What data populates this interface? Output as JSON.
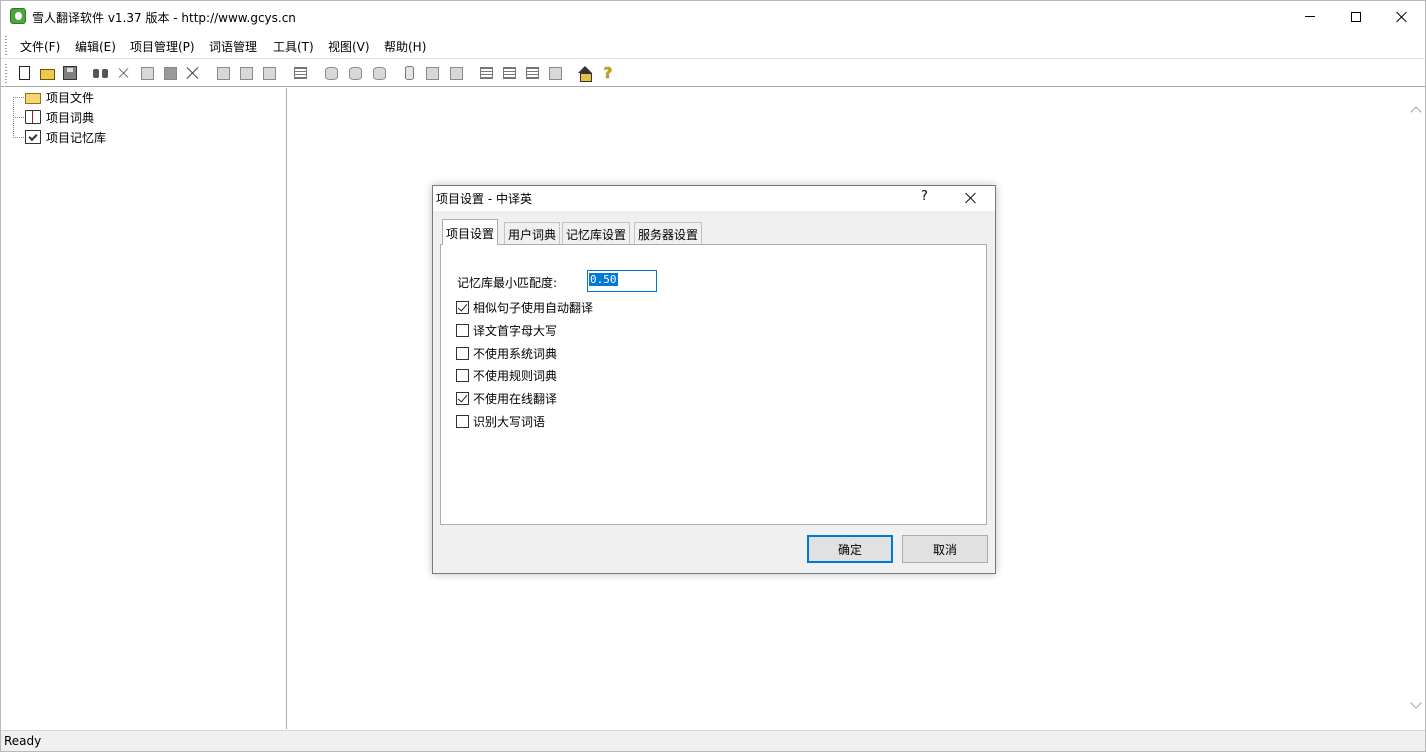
{
  "window": {
    "title": "雪人翻译软件 v1.37 版本 - http://www.gcys.cn",
    "icon": "app-logo-icon"
  },
  "menu": [
    "文件(F)",
    "编辑(E)",
    "项目管理(P)",
    "词语管理",
    "工具(T)",
    "视图(V)",
    "帮助(H)"
  ],
  "toolbar": {
    "icons": [
      "new-document-icon",
      "open-folder-icon",
      "save-icon",
      "find-icon",
      "cut-icon",
      "copy-icon",
      "paste-icon",
      "delete-icon",
      "project-icon",
      "project-settings-icon",
      "project-export-icon",
      "edit-note-icon",
      "database-add-icon",
      "database-edit-icon",
      "database-lock-icon",
      "memory-icon",
      "import-icon",
      "export-icon",
      "list-icon",
      "align-icon",
      "format-icon",
      "connect-icon",
      "home-icon",
      "help-icon"
    ]
  },
  "tree": {
    "items": [
      {
        "label": "项目文件",
        "icon": "folder-icon"
      },
      {
        "label": "项目词典",
        "icon": "dictionary-book-icon"
      },
      {
        "label": "项目记忆库",
        "icon": "memory-library-icon"
      }
    ]
  },
  "status": {
    "text": "Ready"
  },
  "dialog": {
    "title": "项目设置 - 中译英",
    "help": "?",
    "tabs": [
      "项目设置",
      "用户词典",
      "记忆库设置",
      "服务器设置"
    ],
    "active_tab": "项目设置",
    "match_label": "记忆库最小匹配度:",
    "match_value": "0.50",
    "options": [
      {
        "label": "相似句子使用自动翻译",
        "checked": true
      },
      {
        "label": "译文首字母大写",
        "checked": false
      },
      {
        "label": "不使用系统词典",
        "checked": false
      },
      {
        "label": "不使用规则词典",
        "checked": false
      },
      {
        "label": "不使用在线翻译",
        "checked": true
      },
      {
        "label": "识别大写词语",
        "checked": false
      }
    ],
    "ok_label": "确定",
    "cancel_label": "取消"
  },
  "colors": {
    "accent": "#0078d7",
    "dialog_bg": "#f0f0f0",
    "statusbar_bg": "#f0f0f0"
  }
}
